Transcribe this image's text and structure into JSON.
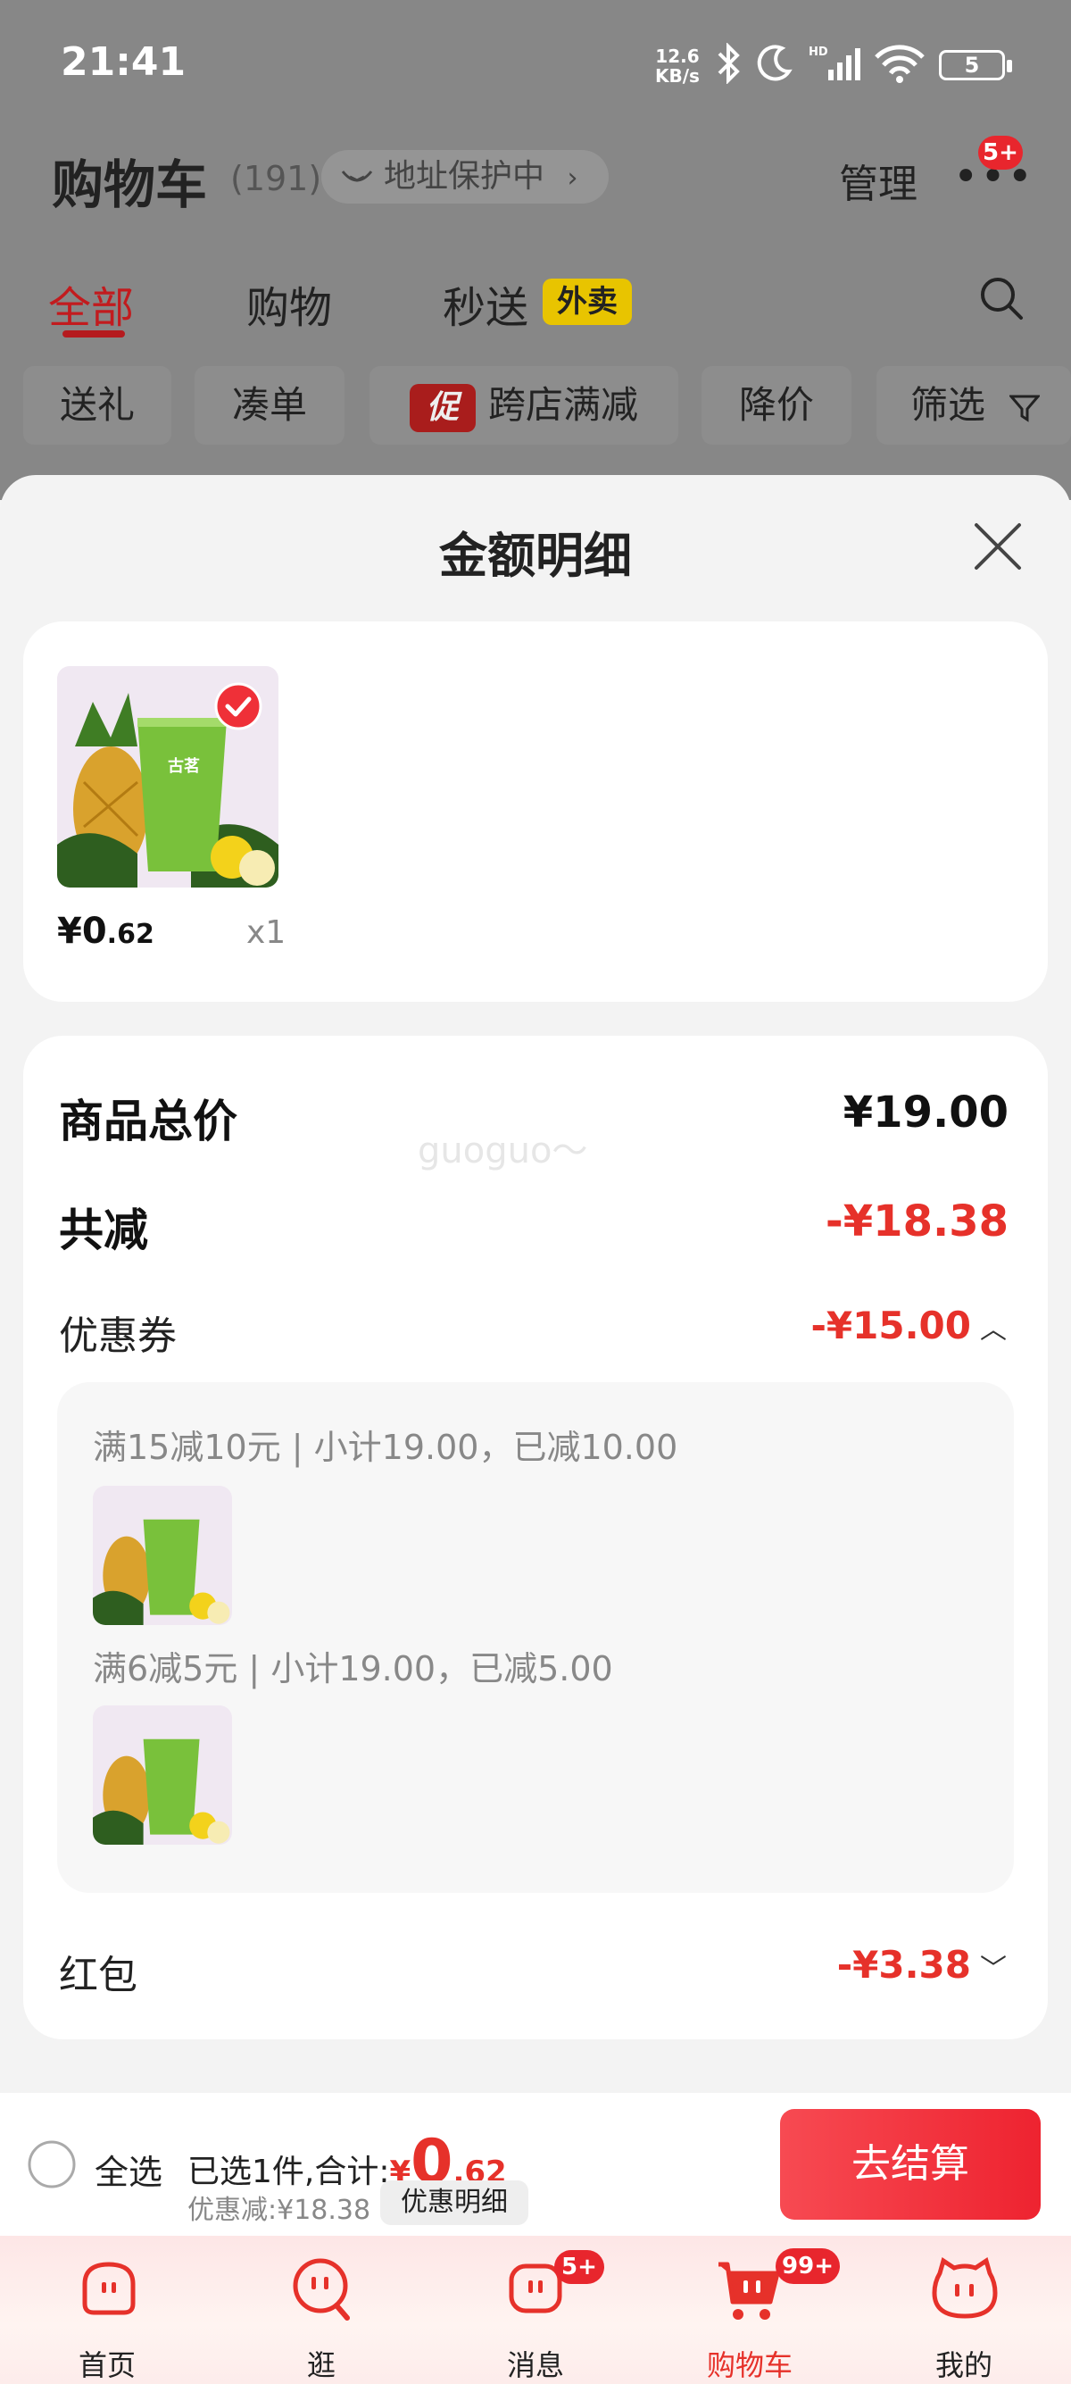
{
  "status_bar": {
    "time": "21:41",
    "net_speed_value": "12.6",
    "net_speed_unit": "KB/s",
    "battery": "5"
  },
  "header": {
    "title": "购物车",
    "count": "(191)",
    "address_badge": "地址保护中",
    "manage": "管理",
    "notify_badge": "5+"
  },
  "tabs": [
    {
      "label": "全部"
    },
    {
      "label": "购物"
    },
    {
      "label": "秒送"
    }
  ],
  "tab_tag": "外卖",
  "chips": [
    {
      "label": "送礼"
    },
    {
      "label": "凑单"
    },
    {
      "label": "跨店满减",
      "tag": "促"
    },
    {
      "label": "降价"
    },
    {
      "label": "筛选"
    }
  ],
  "sheet": {
    "title": "金额明细",
    "product": {
      "product_price_int": "¥0",
      "product_price_dec": ".62",
      "qty": "x1",
      "cup_text": "古茗"
    },
    "summary": {
      "total_label": "商品总价",
      "total_value": "¥19.00",
      "reduce_label": "共减",
      "reduce_value": "-¥18.38",
      "coupon_label": "优惠券",
      "coupon_value": "-¥15.00",
      "coupon_details": [
        {
          "text": "满15减10元 | 小计19.00，已减10.00"
        },
        {
          "text": "满6减5元 | 小计19.00，已减5.00"
        }
      ],
      "redpacket_label": "红包",
      "redpacket_value": "-¥3.38"
    },
    "watermark": "guoguo～"
  },
  "bottom": {
    "select_all": "全选",
    "selected_prefix": "已选1件,合计:",
    "total_currency": "¥",
    "total_int": "0",
    "total_dec": ".62",
    "discount": "优惠减:¥18.38",
    "detail_button": "优惠明细",
    "checkout": "去结算"
  },
  "nav": [
    {
      "label": "首页",
      "badge": ""
    },
    {
      "label": "逛",
      "badge": ""
    },
    {
      "label": "消息",
      "badge": "5+"
    },
    {
      "label": "购物车",
      "badge": "99+"
    },
    {
      "label": "我的",
      "badge": ""
    }
  ],
  "colors": {
    "accent_red": "#e6312a",
    "tab_red": "#c21b1e",
    "waimai_yellow": "#e8c400",
    "overlay_gray": "#878787"
  }
}
